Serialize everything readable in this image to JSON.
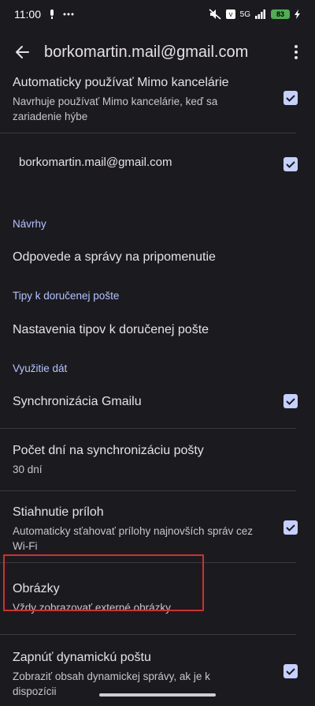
{
  "status_bar": {
    "time": "11:00",
    "battery": "83",
    "signal_label": "5G"
  },
  "app_bar": {
    "title": "borkomartin.mail@gmail.com"
  },
  "settings": {
    "auto_ooo": {
      "title": "Automaticky používať Mimo kancelárie",
      "subtitle": "Navrhuje používať Mimo kancelárie, keď sa zariadenie hýbe",
      "checked": true
    },
    "account": {
      "title": "borkomartin.mail@gmail.com",
      "checked": true
    },
    "navrhy_header": "Návrhy",
    "replies": {
      "title": "Odpovede a správy na pripomenutie"
    },
    "tips_header": "Tipy k doručenej pošte",
    "tips": {
      "title": "Nastavenia tipov k doručenej pošte"
    },
    "data_header": "Využitie dát",
    "sync": {
      "title": "Synchronizácia Gmailu",
      "checked": true
    },
    "sync_days": {
      "title": "Počet dní na synchronizáciu pošty",
      "subtitle": "30 dní"
    },
    "attachments": {
      "title": "Stiahnutie príloh",
      "subtitle": "Automaticky sťahovať prílohy najnovších správ cez Wi-Fi",
      "checked": true
    },
    "images": {
      "title": "Obrázky",
      "subtitle": "Vždy zobrazovať externé obrázky"
    },
    "dynamic": {
      "title": "Zapnúť dynamickú poštu",
      "subtitle": "Zobraziť obsah dynamickej správy, ak je k dispozícii",
      "checked": true
    }
  },
  "colors": {
    "background": "#1b1b1f",
    "checkbox": "#c6d0ff",
    "section_header": "#b3c3ff",
    "highlight": "#d32f2f"
  }
}
